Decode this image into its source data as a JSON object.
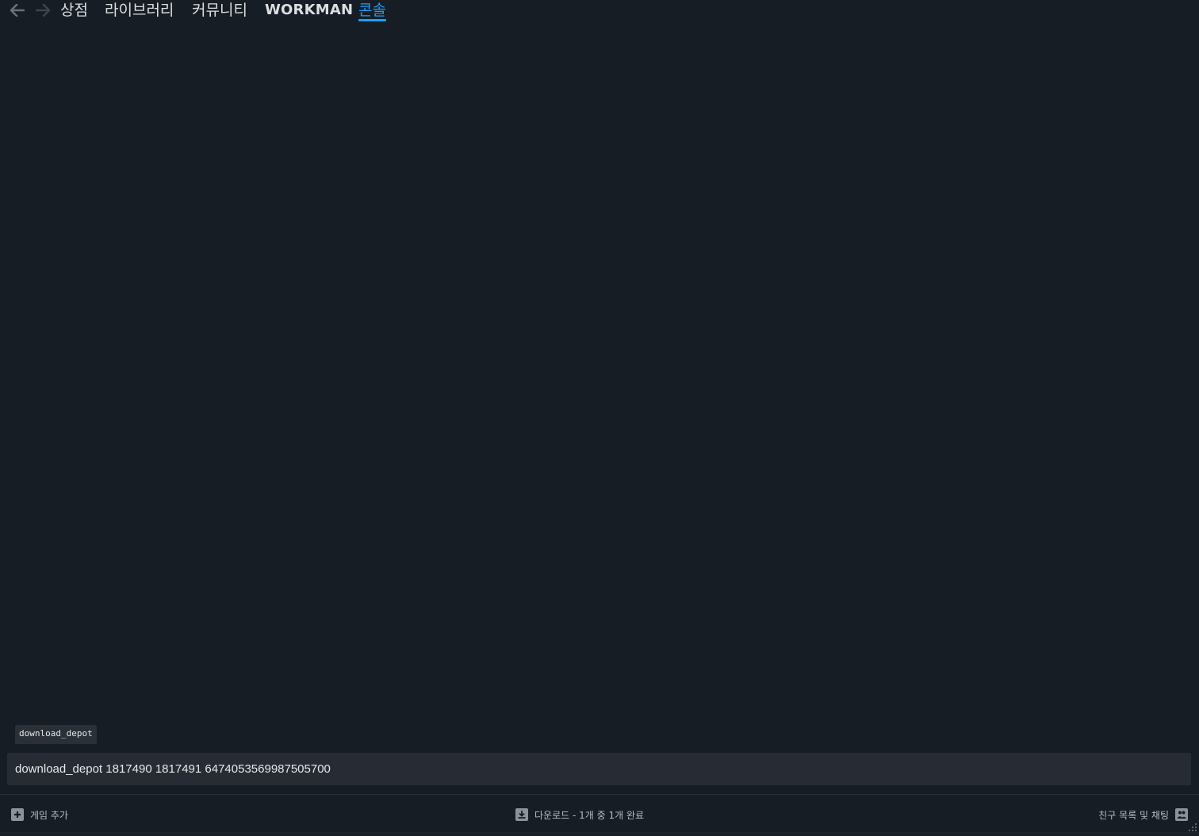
{
  "nav": {
    "back_icon": "arrow-left-icon",
    "forward_icon": "arrow-right-icon",
    "tabs": [
      {
        "label": "상점"
      },
      {
        "label": "라이브러리"
      },
      {
        "label": "커뮤니티"
      },
      {
        "label": "WORKMAN"
      },
      {
        "label": "콘솔"
      }
    ],
    "active_tab": "콘솔",
    "accent_color": "#1a9fff"
  },
  "console": {
    "suggestion": "download_depot",
    "input_value": "download_depot 1817490 1817491 6474053569987505700"
  },
  "bottombar": {
    "add_game_label": "게임 추가",
    "add_game_icon": "plus-box-icon",
    "downloads_label": "다운로드 - 1개 중 1개 완료",
    "downloads_icon": "download-icon",
    "friends_label": "친구 목록 및 채팅",
    "friends_icon": "friends-icon"
  },
  "colors": {
    "background": "#171d25",
    "input_background": "#272c34",
    "text": "#dcdedf"
  }
}
